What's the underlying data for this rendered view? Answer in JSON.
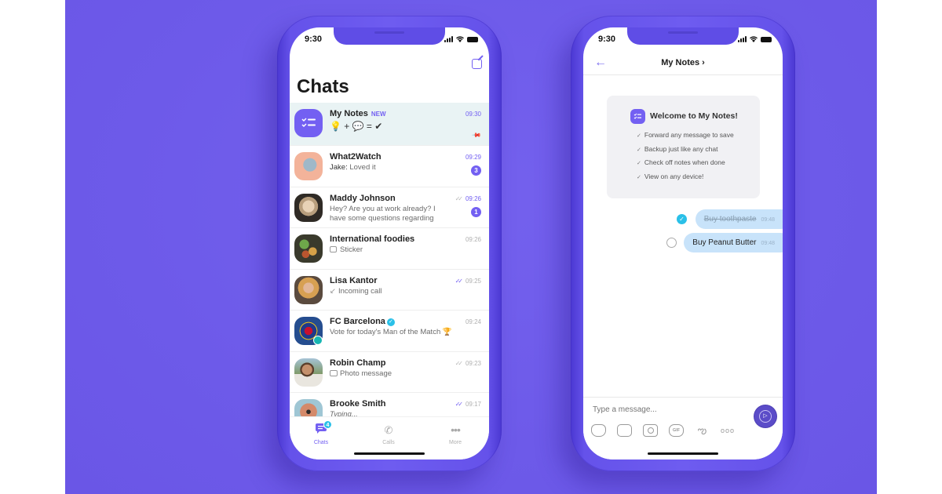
{
  "colors": {
    "background": "#6d5ae9",
    "accent": "#7360f2",
    "verified": "#2ac0e8",
    "note_bubble": "#c8e3fa",
    "pinned_row": "#e9f3f4"
  },
  "left_phone": {
    "status_bar": {
      "time": "9:30",
      "icons": [
        "signal-icon",
        "wifi-icon",
        "battery-icon"
      ]
    },
    "compose_icon": "compose-icon",
    "title": "Chats",
    "chats": [
      {
        "name": "My Notes",
        "tag": "NEW",
        "preview": "💡 + 💬 = ✔",
        "time": "09:30",
        "time_unread": true,
        "pinned": true,
        "avatar": "notes-icon"
      },
      {
        "name": "What2Watch",
        "sender": "Jake:",
        "preview": " Loved it",
        "time": "09:29",
        "time_unread": true,
        "unread_count": "3",
        "avatar": "what2watch-avatar"
      },
      {
        "name": "Maddy Johnson",
        "preview": "Hey? Are you at work already? I have some questions regarding",
        "time": "09:26",
        "time_unread": true,
        "ticks": "delivered",
        "unread_count": "1",
        "avatar": "maddy-avatar"
      },
      {
        "name": "International foodies",
        "preview": "Sticker",
        "preview_icon": "sticker-icon",
        "time": "09:26",
        "avatar": "foodies-avatar"
      },
      {
        "name": "Lisa Kantor",
        "preview": "Incoming call",
        "preview_icon": "call-arrow-icon",
        "time": "09:25",
        "ticks": "read",
        "avatar": "lisa-avatar"
      },
      {
        "name": "FC Barcelona",
        "verified": true,
        "preview": "Vote for today's Man of the Match 🏆",
        "time": "09:24",
        "bot": true,
        "avatar": "fcb-avatar"
      },
      {
        "name": "Robin Champ",
        "preview": "Photo message",
        "preview_icon": "photo-icon",
        "time": "09:23",
        "ticks": "delivered",
        "avatar": "robin-avatar"
      },
      {
        "name": "Brooke Smith",
        "preview": "Typing...",
        "italic": true,
        "time": "09:17",
        "ticks": "read",
        "avatar": "brooke-avatar"
      }
    ],
    "tabs": [
      {
        "label": "Chats",
        "icon": "chats-icon",
        "active": true,
        "badge": "4"
      },
      {
        "label": "Calls",
        "icon": "phone-icon",
        "active": false
      },
      {
        "label": "More",
        "icon": "more-icon",
        "active": false
      }
    ]
  },
  "right_phone": {
    "status_bar": {
      "time": "9:30"
    },
    "header": {
      "title": "My Notes ›",
      "back_icon": "back-arrow-icon"
    },
    "welcome": {
      "title": "Welcome to My Notes!",
      "items": [
        "Forward any message to save",
        "Backup just like any chat",
        "Check off notes when done",
        "View on any device!"
      ]
    },
    "notes": [
      {
        "text": "Buy toothpaste",
        "time": "09:48",
        "done": true
      },
      {
        "text": "Buy Peanut Butter",
        "time": "09:48",
        "done": false
      }
    ],
    "composer": {
      "placeholder": "Type a message...",
      "tools": [
        "sticker-icon",
        "gallery-icon",
        "camera-icon",
        "gif-icon",
        "doodle-icon",
        "more-icon"
      ],
      "gif_label": "GIF"
    }
  }
}
